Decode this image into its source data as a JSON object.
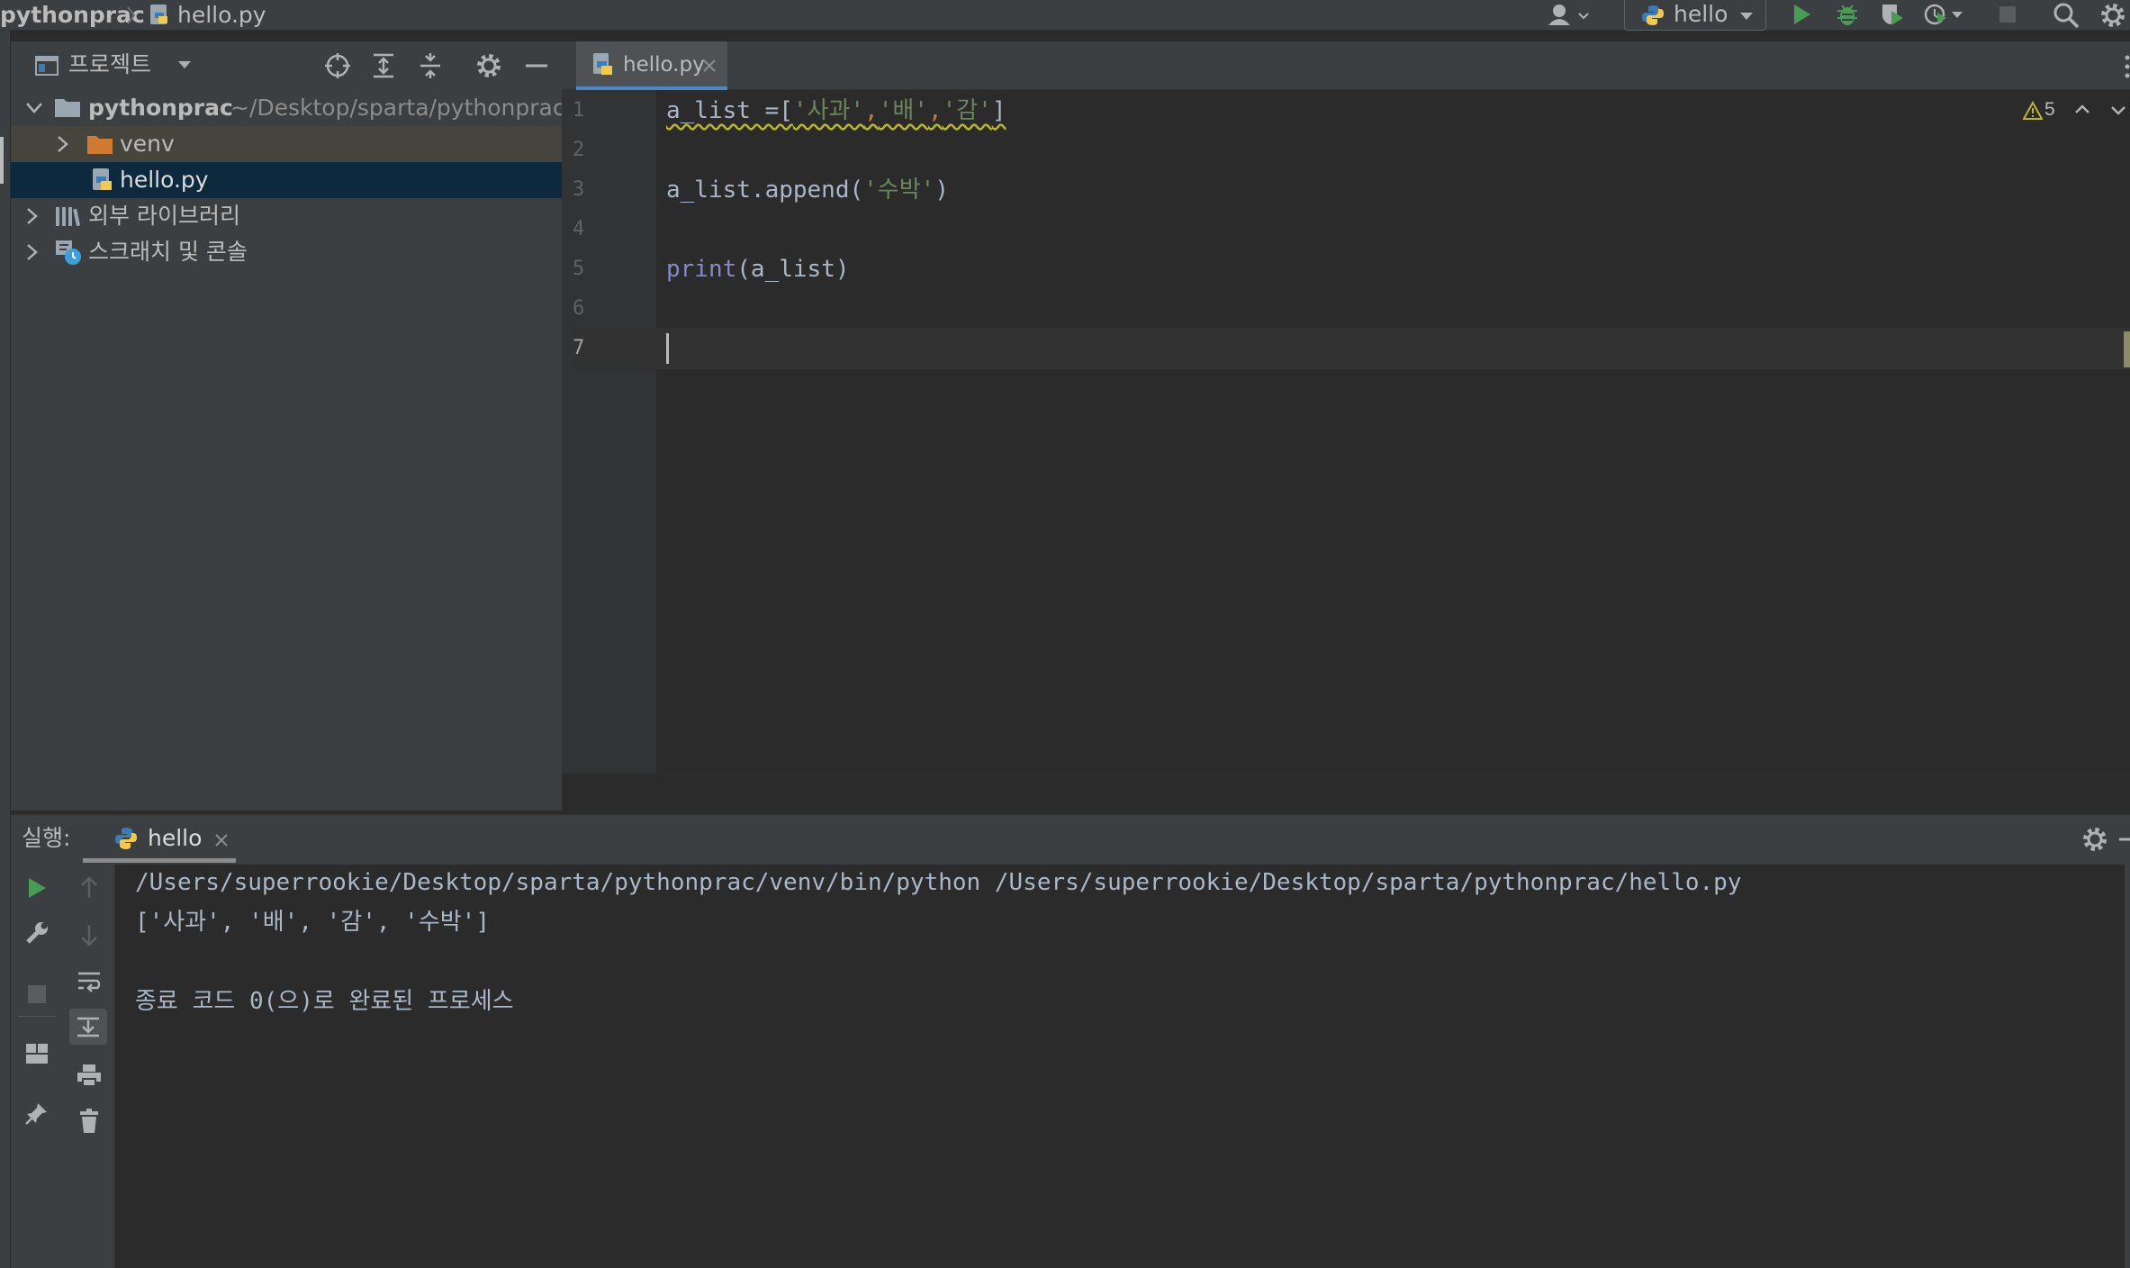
{
  "titlebar": {
    "project": "pythonprac",
    "file": "hello.py",
    "run_config": "hello"
  },
  "project_panel": {
    "title": "프로젝트",
    "root_name": "pythonprac",
    "root_path": "~/Desktop/sparta/pythonprac",
    "items": [
      {
        "label": "venv",
        "icon": "folder-icon"
      },
      {
        "label": "hello.py",
        "icon": "python-file-icon"
      },
      {
        "label": "외부 라이브러리",
        "icon": "library-icon"
      },
      {
        "label": "스크래치 및 콘솔",
        "icon": "scratch-icon"
      }
    ]
  },
  "editor": {
    "tab_label": "hello.py",
    "warning_count": "5",
    "lines": [
      {
        "num": "1"
      },
      {
        "num": "2"
      },
      {
        "num": "3"
      },
      {
        "num": "4"
      },
      {
        "num": "5"
      },
      {
        "num": "6"
      },
      {
        "num": "7"
      }
    ],
    "code": {
      "l1_var": "a_list =[",
      "l1_s1": "'사과'",
      "l1_c1": ",",
      "l1_s2": "'배'",
      "l1_c2": ",",
      "l1_s3": "'감'",
      "l1_end": "]",
      "l3_call": "a_list.append(",
      "l3_str": "'수박'",
      "l3_end": ")",
      "l5_fn": "print",
      "l5_args": "(a_list)"
    }
  },
  "run_panel": {
    "label": "실행:",
    "tab_label": "hello",
    "output": [
      "/Users/superrookie/Desktop/sparta/pythonprac/venv/bin/python /Users/superrookie/Desktop/sparta/pythonprac/hello.py",
      "['사과', '배', '감', '수박']",
      "",
      "종료 코드 0(으)로 완료된 프로세스"
    ]
  },
  "colors": {
    "background": "#2b2b2b",
    "panel": "#3c3f41",
    "selection": "#0d293e",
    "string": "#6a8759",
    "builtin": "#8888c6",
    "accent_run": "#499c54",
    "tab_underline": "#4a88c7"
  }
}
